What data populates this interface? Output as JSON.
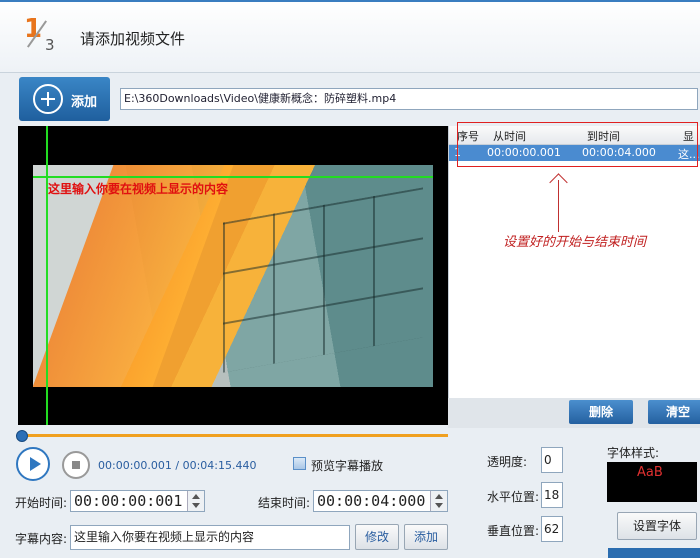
{
  "header": {
    "step_numerator": "1",
    "step_denominator": "3",
    "title": "请添加视频文件"
  },
  "toolbar": {
    "add_label": "添加",
    "file_path": "E:\\360Downloads\\Video\\健康新概念：防碎塑料.mp4"
  },
  "video": {
    "subtitle_overlay": "这里输入你要在视频上显示的内容"
  },
  "table": {
    "columns": [
      "序号",
      "从时间",
      "到时间",
      "显"
    ],
    "rows": [
      {
        "index": "1",
        "from": "00:00:00.001",
        "to": "00:00:04.000",
        "text": "这..."
      }
    ],
    "delete_label": "删除",
    "clear_label": "清空"
  },
  "annotation": {
    "text": "设置好的开始与结束时间"
  },
  "playback": {
    "time_readout": "00:00:00.001 / 00:04:15.440",
    "preview_label": "预览字幕播放",
    "progress": 0.0
  },
  "subtitle_form": {
    "start_label": "开始时间:",
    "start_value": "00:00:00:001",
    "end_label": "结束时间:",
    "end_value": "00:00:04:000",
    "content_label": "字幕内容:",
    "content_value": "这里输入你要在视频上显示的内容",
    "modify_label": "修改",
    "add_label": "添加"
  },
  "style_panel": {
    "opacity_label": "透明度:",
    "opacity_value": "0",
    "hpos_label": "水平位置:",
    "hpos_value": "18",
    "vpos_label": "垂直位置:",
    "vpos_value": "62",
    "font_style_label": "字体样式:",
    "font_preview_text": "AaB",
    "set_font_label": "设置字体"
  },
  "colors": {
    "accent_blue": "#2c6fb6",
    "highlight_red": "#e02020",
    "guide_green": "#22dd22",
    "progress_orange": "#f0a020"
  }
}
